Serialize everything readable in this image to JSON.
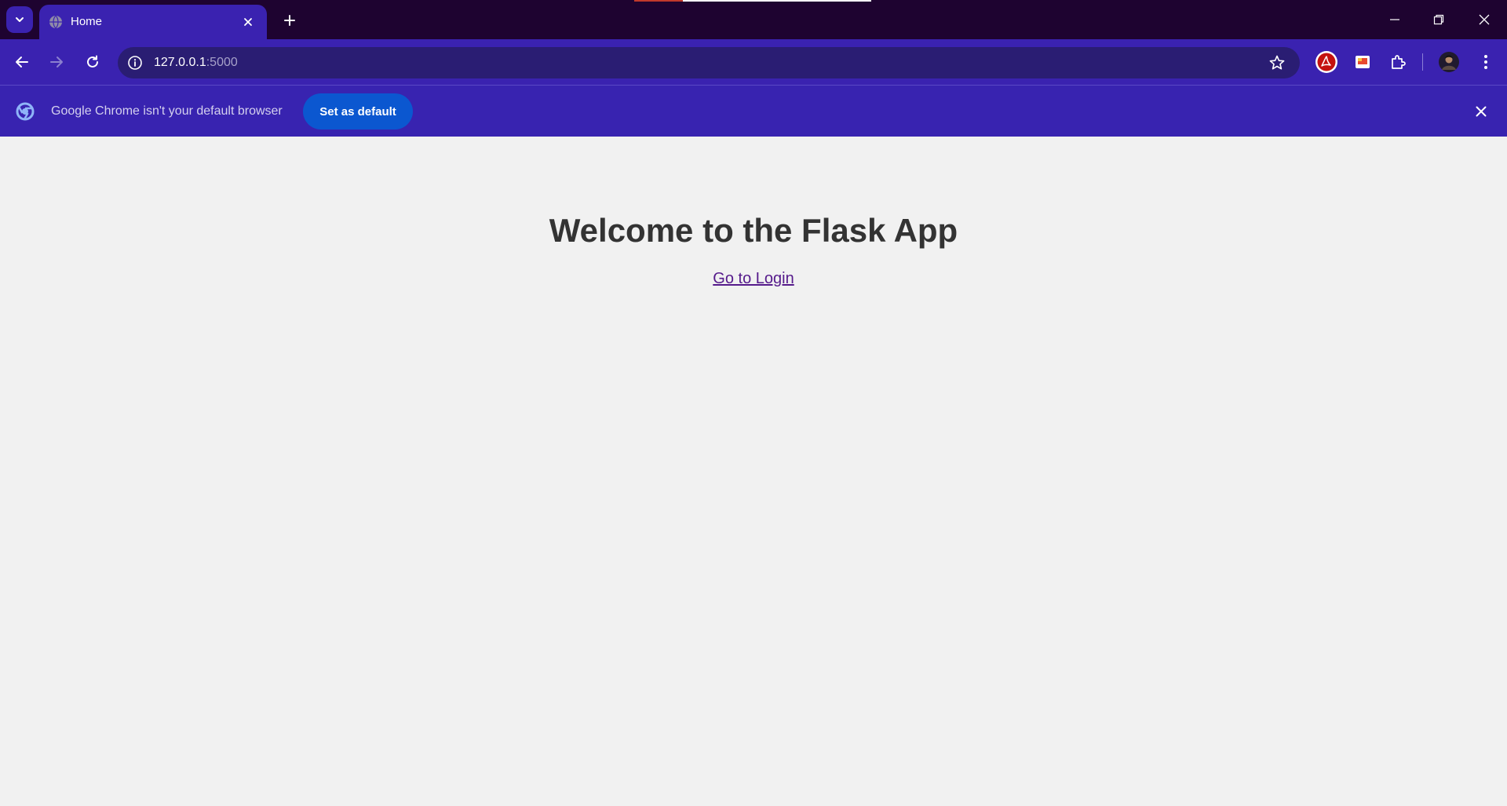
{
  "browser": {
    "tab": {
      "title": "Home"
    },
    "omnibox": {
      "host": "127.0.0.1",
      "port": ":5000"
    }
  },
  "infobar": {
    "message": "Google Chrome isn't your default browser",
    "button_label": "Set as default"
  },
  "page": {
    "heading": "Welcome to the Flask App",
    "login_link": "Go to Login"
  },
  "colors": {
    "tabstrip_bg": "#1e0330",
    "toolbar_bg": "#3a22b0",
    "omnibox_bg": "#2a1d73",
    "infobar_bg": "#3823b0",
    "button_blue": "#0b57d0",
    "page_bg": "#f1f1f1",
    "heading_text": "#333333",
    "visited_link": "#551a8b"
  }
}
